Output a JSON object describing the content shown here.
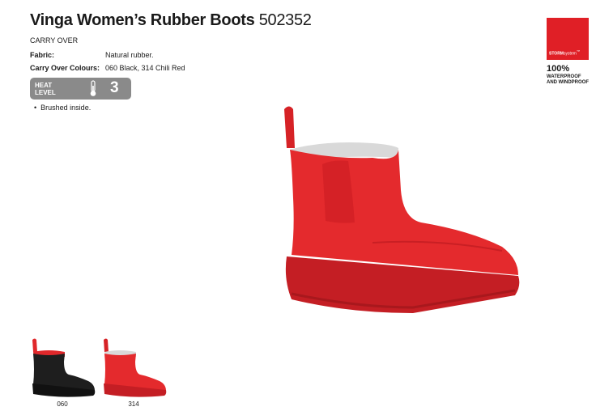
{
  "product": {
    "name": "Vinga Women’s Rubber Boots",
    "code": "502352",
    "status": "CARRY OVER"
  },
  "specs": [
    {
      "label": "Fabric:",
      "value": "Natural rubber."
    },
    {
      "label": "Carry Over Colours:",
      "value": "060 Black, 314 Chili Red"
    }
  ],
  "heat": {
    "label_line1": "HEAT",
    "label_line2": "LEVEL",
    "value": "3",
    "icon": "thermometer-icon"
  },
  "features": [
    "Brushed inside."
  ],
  "badge": {
    "brand_bold": "STORM",
    "brand_rest": "system",
    "mark": "™",
    "percent": "100%",
    "line1": "WATERPROOF",
    "line2": "AND WINDPROOF"
  },
  "colors_swatches": [
    {
      "code": "060",
      "color": "#1c1c1c"
    },
    {
      "code": "314",
      "color": "#e0282b"
    }
  ],
  "colors": {
    "accent_red": "#e01f26",
    "boot_red": "#e0282b",
    "sole_red": "#c41e24",
    "heat_grey": "#8a8a8a"
  }
}
